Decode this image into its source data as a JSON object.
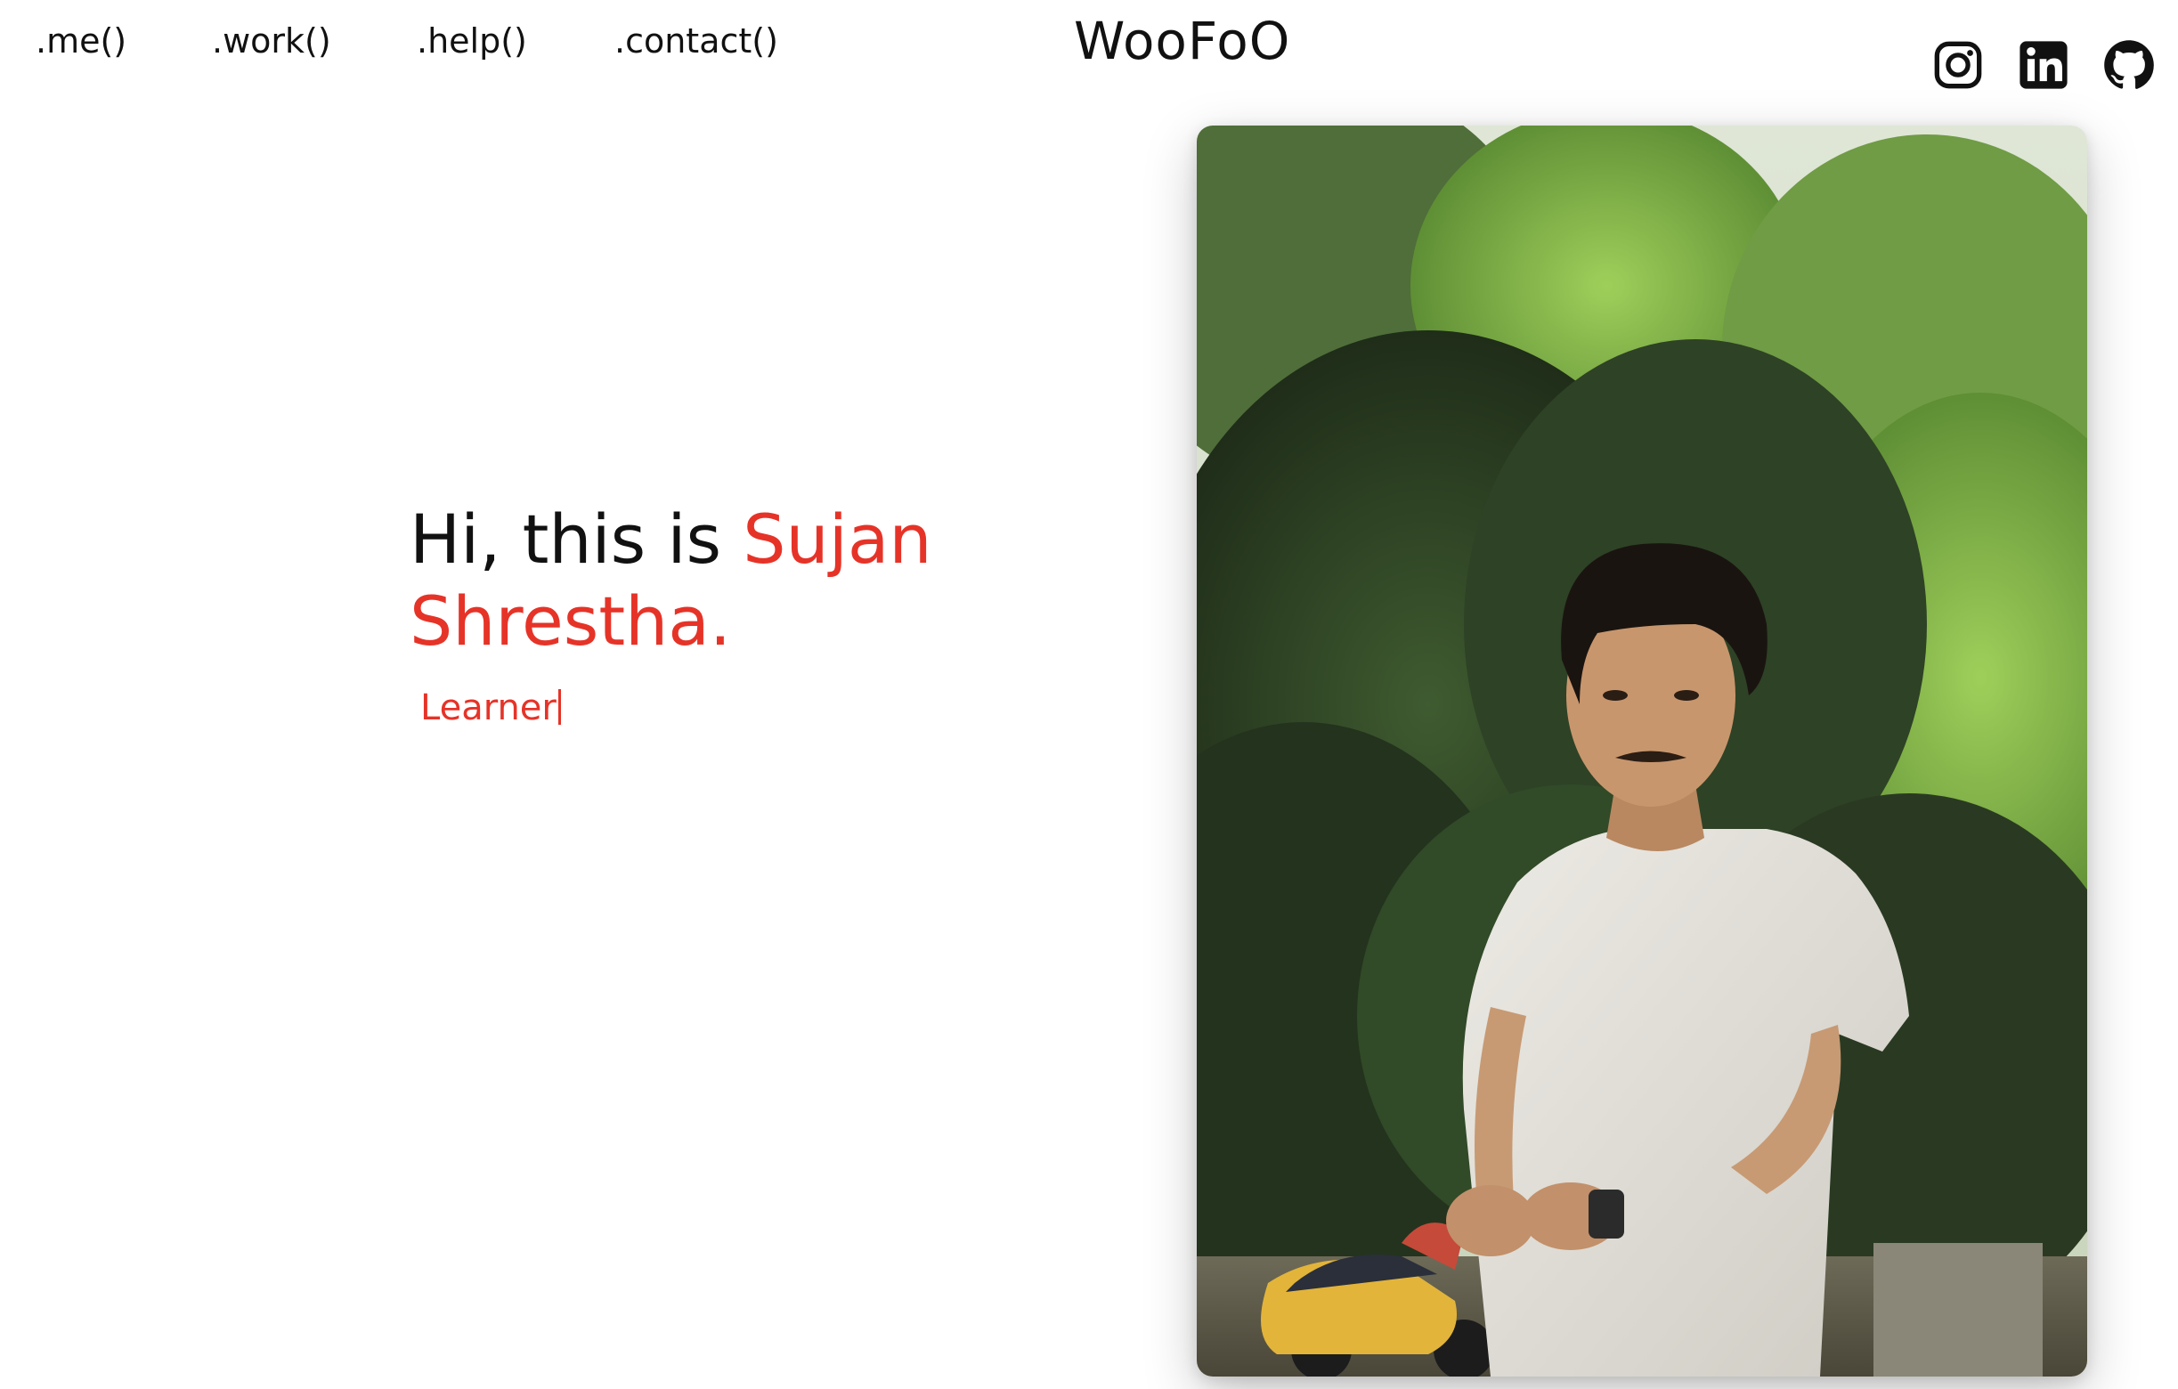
{
  "nav": {
    "items": [
      ".me()",
      ".work()",
      ".help()",
      ".contact()"
    ]
  },
  "brand": "WooFoO",
  "socials": {
    "icons": [
      "instagram-icon",
      "linkedin-icon",
      "github-icon"
    ]
  },
  "hero": {
    "greeting": "Hi, this is ",
    "first_name": "Sujan",
    "last_name": "Shrestha.",
    "role": "Learner"
  },
  "colors": {
    "accent": "#e63328",
    "text": "#111111",
    "background": "#ffffff"
  }
}
